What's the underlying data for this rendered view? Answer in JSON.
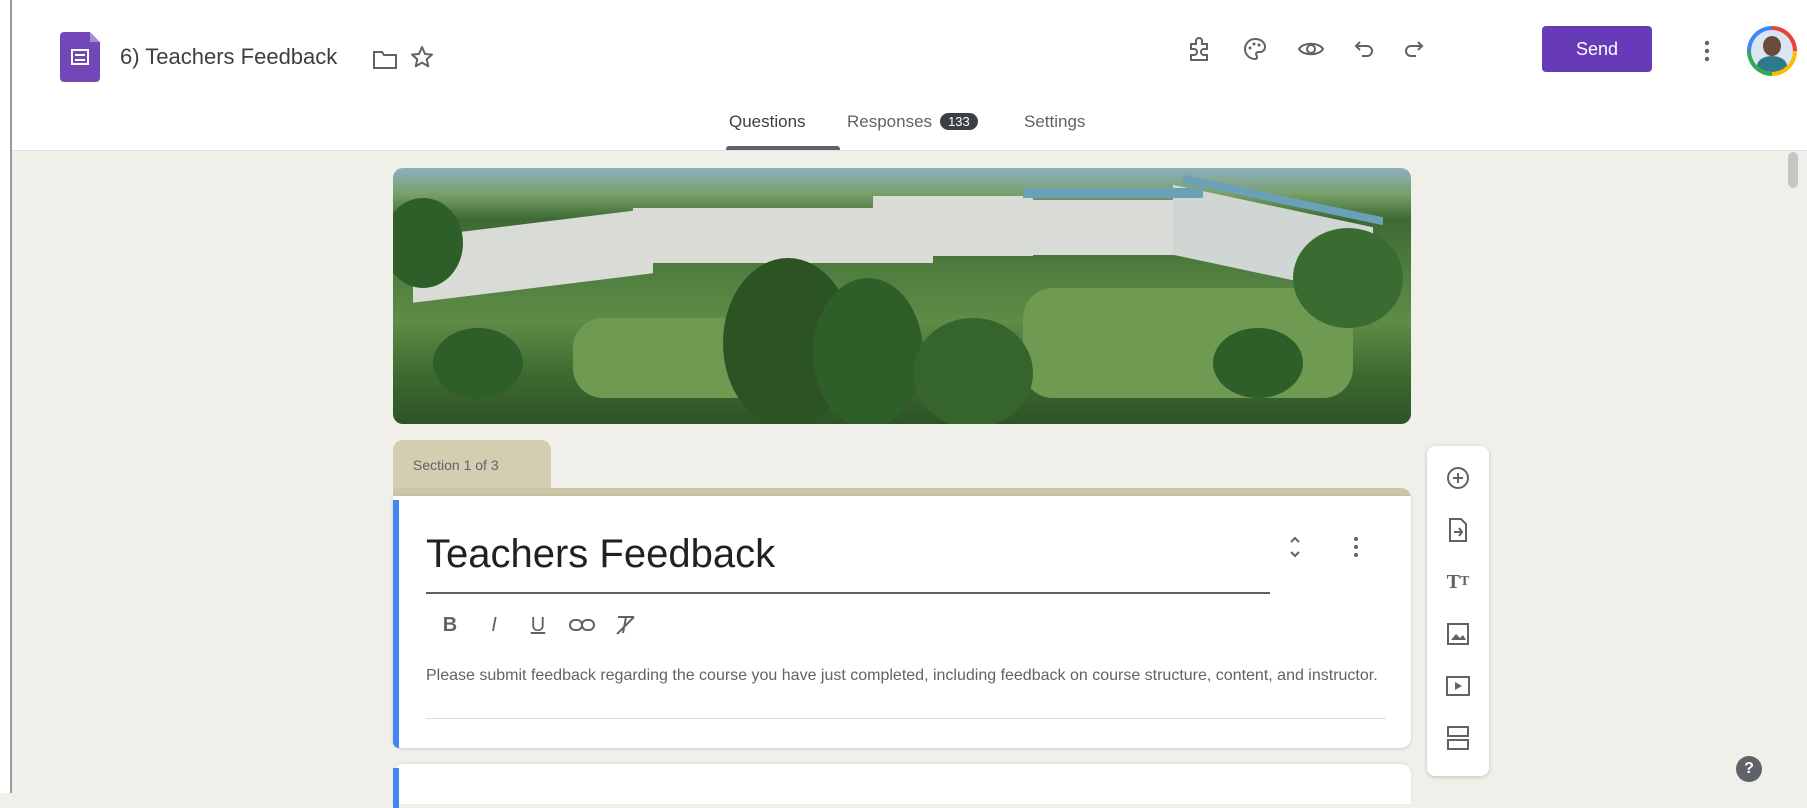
{
  "header": {
    "doc_title": "6) Teachers Feedback",
    "send_label": "Send",
    "icons": [
      "forms-logo-icon",
      "folder-icon",
      "star-icon",
      "addon-icon",
      "palette-icon",
      "preview-eye-icon",
      "undo-icon",
      "redo-icon",
      "more-vert-icon",
      "avatar"
    ]
  },
  "tabs": [
    {
      "label": "Questions",
      "active": true
    },
    {
      "label": "Responses",
      "badge": "133"
    },
    {
      "label": "Settings"
    }
  ],
  "section": {
    "tab_label": "Section 1 of 3",
    "title": "Teachers Feedback",
    "description": "Please submit feedback regarding the course you have just completed, including feedback on course structure, content, and instructor.",
    "format_buttons": [
      "B",
      "I",
      "U",
      "link",
      "clear-format"
    ]
  },
  "side_toolbar": [
    "add-question-icon",
    "import-questions-icon",
    "add-title-icon",
    "add-image-icon",
    "add-video-icon",
    "add-section-icon"
  ],
  "help_label": "?",
  "colors": {
    "accent": "#673ab7",
    "theme_tab": "#d3ceb2",
    "card_accent": "#4285f4",
    "background": "#f0efe9"
  }
}
